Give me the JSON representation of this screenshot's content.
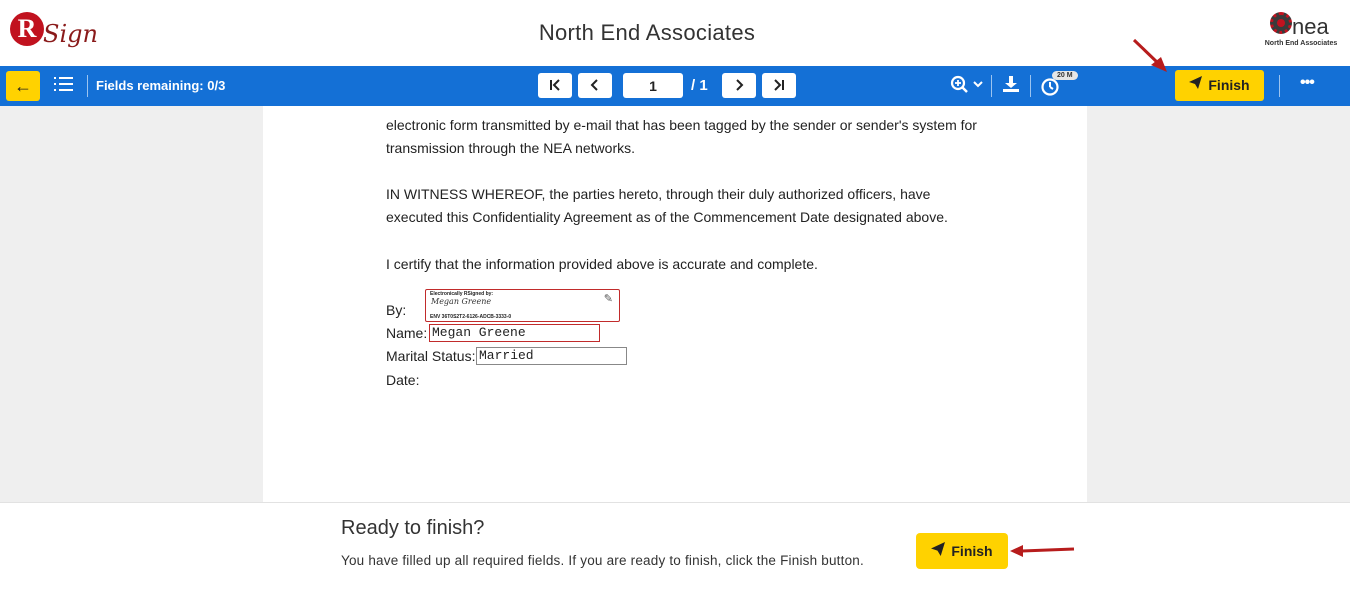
{
  "header": {
    "logo_letter": "R",
    "logo_text": "Sign",
    "org_title": "North End Associates",
    "partner_logo_text": "nea",
    "partner_logo_sub": "North End Associates"
  },
  "toolbar": {
    "back_icon": "arrow-left-icon",
    "menu_icon": "hamburger-icon",
    "fields_remaining": "Fields remaining: 0/3",
    "first_label": "|<",
    "prev_label": "<",
    "page_value": "1",
    "page_total": "/ 1",
    "next_label": ">",
    "last_label": ">|",
    "zoom_icon": "zoom-in-icon",
    "download_icon": "download-icon",
    "timer_icon": "timer-icon",
    "timer_badge": "20 M",
    "finish_label": "Finish",
    "more_icon": "ellipsis-icon",
    "accent": "#1470d6",
    "button_color": "#ffd200"
  },
  "document": {
    "para1_line1": "electronic form transmitted by e-mail that has been tagged by the sender or sender's system for",
    "para1_line2": "transmission through the NEA networks.",
    "para2_line1": "IN WITNESS WHEREOF, the parties hereto, through their duly authorized officers, have",
    "para2_line2": "executed this Confidentiality Agreement as of the Commencement Date designated above.",
    "certify": "I certify that the information provided above is accurate and complete.",
    "by_label": "By:",
    "name_label": "Name:",
    "marital_label": "Marital Status:",
    "date_label": "Date:",
    "signature": {
      "header": "Electronically RSigned by:",
      "signer": "Megan Greene",
      "envelope_id": "ENV 36T0S2T2-6126-ADCB-3333-0"
    },
    "name_value": "Megan Greene",
    "marital_value": "Married"
  },
  "footer": {
    "title": "Ready to finish?",
    "message": "You have filled up all required fields. If you are ready to finish, click the Finish button.",
    "finish_label": "Finish"
  }
}
